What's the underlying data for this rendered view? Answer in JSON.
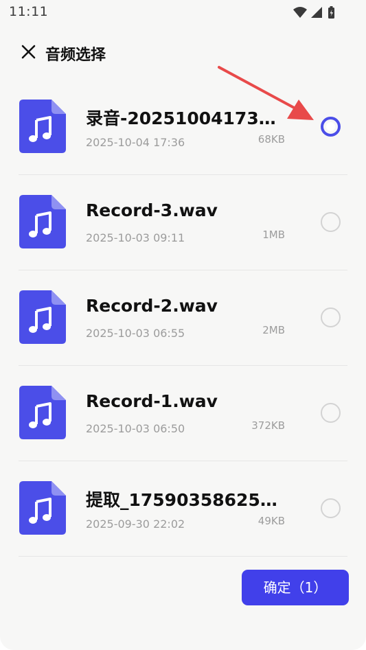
{
  "status_bar": {
    "time": "11:11"
  },
  "header": {
    "title": "音频选择"
  },
  "files": [
    {
      "name": "录音-202510041736...",
      "date": "2025-10-04 17:36",
      "size": "68KB",
      "selected": true
    },
    {
      "name": "Record-3.wav",
      "date": "2025-10-03 09:11",
      "size": "1MB",
      "selected": false
    },
    {
      "name": "Record-2.wav",
      "date": "2025-10-03 06:55",
      "size": "2MB",
      "selected": false
    },
    {
      "name": "Record-1.wav",
      "date": "2025-10-03 06:50",
      "size": "372KB",
      "selected": false
    },
    {
      "name": "提取_175903586256...",
      "date": "2025-09-30 22:02",
      "size": "49KB",
      "selected": false
    }
  ],
  "confirm_button": {
    "label": "确定（1）"
  },
  "colors": {
    "accent": "#4140ea",
    "file_icon": "#4b4ee8",
    "annotation_arrow": "#e84a4a"
  }
}
